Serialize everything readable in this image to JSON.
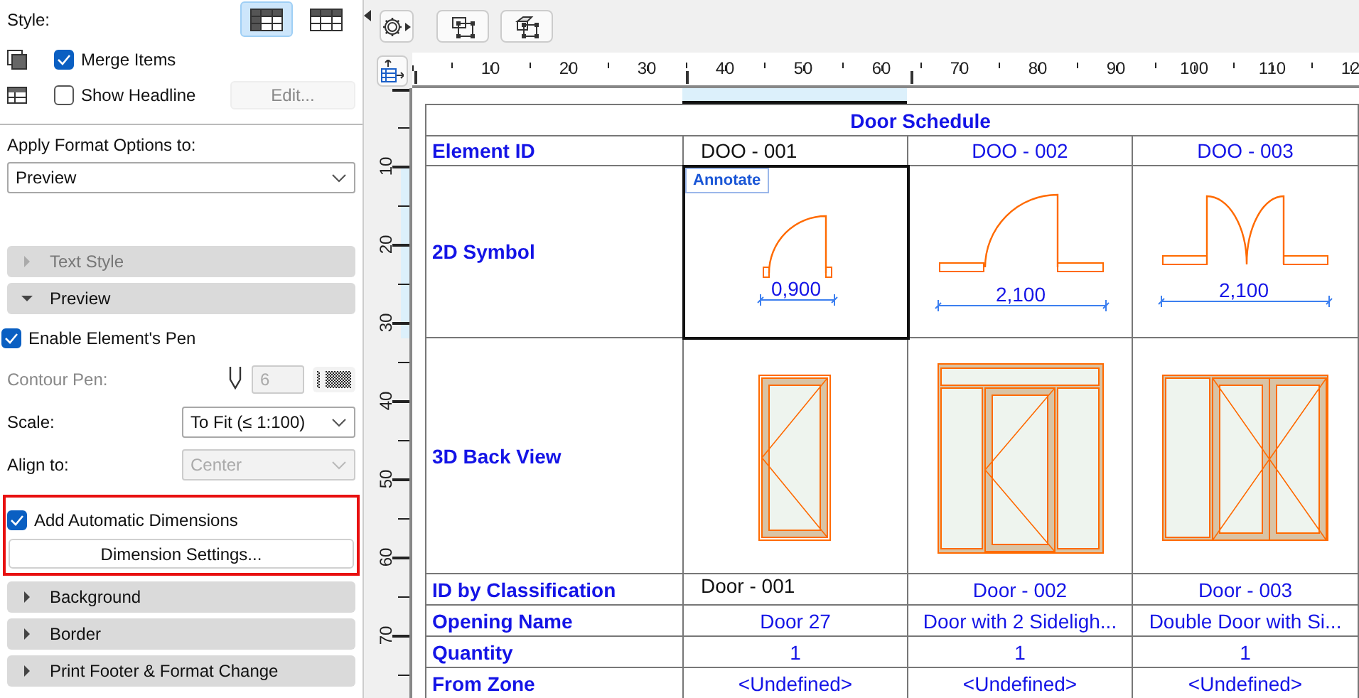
{
  "options_panel": {
    "style_label": "Style:",
    "style_buttons": [
      {
        "selected": true
      },
      {
        "selected": false
      }
    ],
    "merge_items": {
      "label": "Merge Items",
      "checked": true
    },
    "show_headline": {
      "label": "Show Headline",
      "checked": false
    },
    "edit_button": {
      "label": "Edit...",
      "disabled": true
    },
    "apply_format": {
      "label": "Apply Format Options to:",
      "value": "Preview"
    },
    "sections_top": [
      {
        "label": "Text Style",
        "expanded": false,
        "disabled": true
      },
      {
        "label": "Preview",
        "expanded": true,
        "disabled": false
      }
    ],
    "enable_pen": {
      "label": "Enable Element's Pen",
      "checked": true
    },
    "contour_pen": {
      "label": "Contour Pen:",
      "value": "6",
      "disabled": true
    },
    "scale": {
      "label": "Scale:",
      "value": "To Fit (≤ 1:100)"
    },
    "align": {
      "label": "Align to:",
      "value": "Center",
      "disabled": true
    },
    "auto_dimensions": {
      "label": "Add Automatic Dimensions",
      "checked": true,
      "highlighted": true
    },
    "dimension_settings": {
      "label": "Dimension Settings..."
    },
    "sections_bottom": [
      {
        "label": "Background",
        "expanded": false,
        "disabled": false
      },
      {
        "label": "Border",
        "expanded": false,
        "disabled": false
      },
      {
        "label": "Print Footer & Format Change",
        "expanded": false,
        "disabled": false
      }
    ]
  },
  "ruler": {
    "x_labels": [
      "10",
      "20",
      "30",
      "40",
      "50",
      "60",
      "70",
      "80",
      "90",
      "100",
      "110",
      "12"
    ],
    "y_labels": [
      "10",
      "20",
      "30",
      "40",
      "50",
      "60",
      "70"
    ]
  },
  "schedule": {
    "title": "Door Schedule",
    "row_labels": [
      "Element ID",
      "2D Symbol",
      "3D Back View",
      "ID by Classification",
      "Opening Name",
      "Quantity",
      "From Zone"
    ],
    "columns": [
      {
        "selected": true,
        "kind": "single",
        "element_id": "DOO - 001",
        "annotate": "Annotate",
        "dimension": "0,900",
        "classification_id": "Door - 001",
        "opening_name": "Door 27",
        "quantity": "1",
        "from_zone": "<Undefined>"
      },
      {
        "selected": false,
        "kind": "sidelights",
        "element_id": "DOO - 002",
        "dimension": "2,100",
        "classification_id": "Door - 002",
        "opening_name": "Door with 2 Sideligh...",
        "quantity": "1",
        "from_zone": "<Undefined>"
      },
      {
        "selected": false,
        "kind": "double",
        "element_id": "DOO - 003",
        "dimension": "2,100",
        "classification_id": "Door - 003",
        "opening_name": "Double Door with Si...",
        "quantity": "1",
        "from_zone": "<Undefined>"
      }
    ]
  }
}
